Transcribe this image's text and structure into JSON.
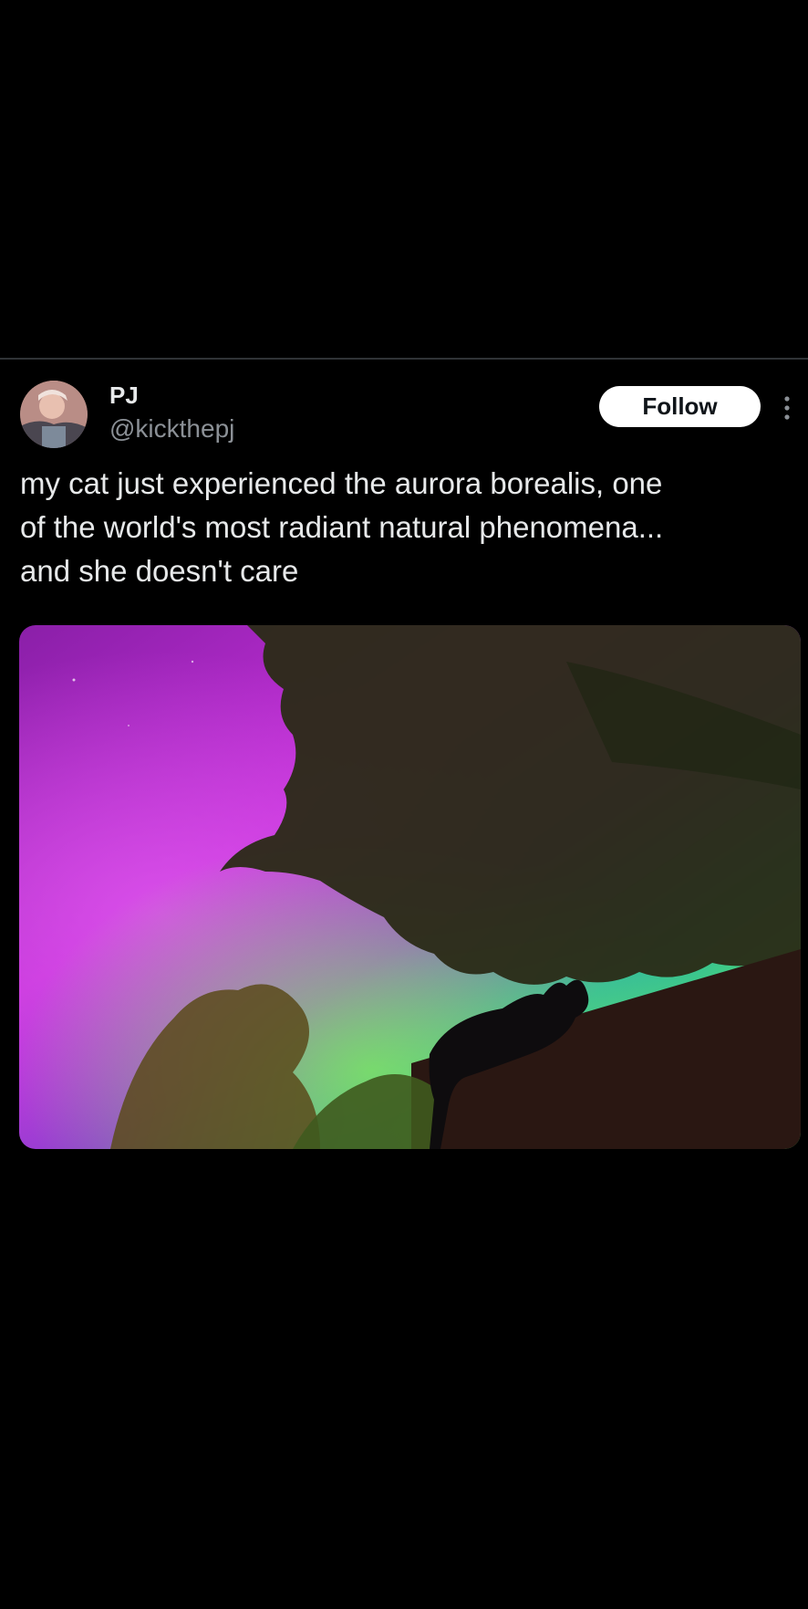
{
  "tweet": {
    "author": {
      "display_name": "PJ",
      "handle": "@kickthepj"
    },
    "follow_label": "Follow",
    "more_icon": "more-vertical-icon",
    "text": "my cat just experienced the aurora borealis, one\nof the world's most radiant natural phenomena...\nand she doesn't care",
    "media": {
      "description_icon": "photo",
      "colors": {
        "aurora_magenta": "#c22fd8",
        "aurora_green": "#52e06a",
        "aurora_teal": "#2fb7a0"
      }
    }
  }
}
